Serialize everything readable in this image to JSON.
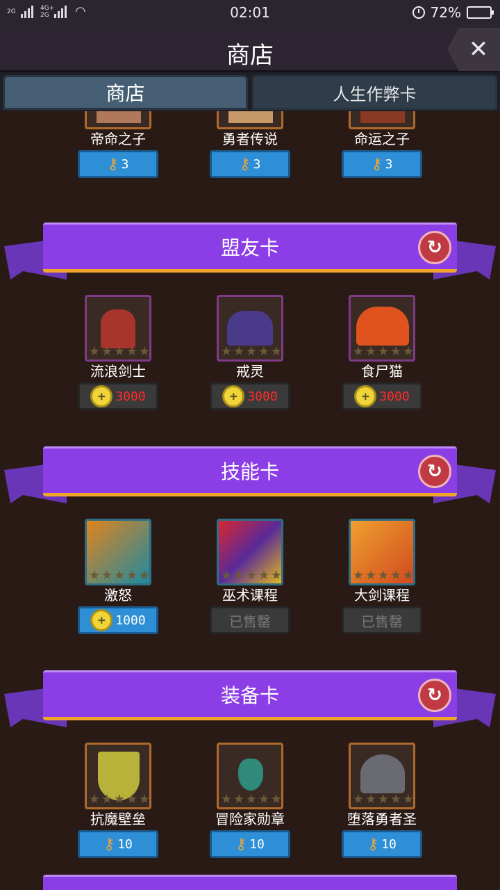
{
  "status_bar": {
    "network_1": "2G",
    "network_2": "4G+\n2G",
    "time": "02:01",
    "battery_percent": "72%",
    "battery_level": 0.72
  },
  "header": {
    "title": "商店",
    "close_label": "✕"
  },
  "tabs": [
    {
      "label": "商店",
      "active": true
    },
    {
      "label": "人生作弊卡",
      "active": false
    }
  ],
  "top_items": [
    {
      "name": "帝命之子",
      "price": "3",
      "currency": "key"
    },
    {
      "name": "勇者传说",
      "price": "3",
      "currency": "key"
    },
    {
      "name": "命运之子",
      "price": "3",
      "currency": "key"
    }
  ],
  "sections": [
    {
      "title": "盟友卡",
      "items": [
        {
          "name": "流浪剑士",
          "price": "3000",
          "currency": "coin",
          "style": "dark"
        },
        {
          "name": "戒灵",
          "price": "3000",
          "currency": "coin",
          "style": "dark"
        },
        {
          "name": "食尸猫",
          "price": "3000",
          "currency": "coin",
          "style": "dark"
        }
      ]
    },
    {
      "title": "技能卡",
      "items": [
        {
          "name": "激怒",
          "price": "1000",
          "currency": "coin",
          "style": "blue"
        },
        {
          "name": "巫术课程",
          "price": "已售罄",
          "currency": "none",
          "style": "sold"
        },
        {
          "name": "大剑课程",
          "price": "已售罄",
          "currency": "none",
          "style": "sold"
        }
      ]
    },
    {
      "title": "装备卡",
      "items": [
        {
          "name": "抗魔壁垒",
          "price": "10",
          "currency": "key",
          "style": "blue"
        },
        {
          "name": "冒险家勋章",
          "price": "10",
          "currency": "key",
          "style": "blue"
        },
        {
          "name": "堕落勇者圣",
          "price": "10",
          "currency": "key",
          "style": "blue"
        }
      ]
    }
  ],
  "colors": {
    "background": "#2a1a16",
    "banner": "#8c3ee6",
    "price_blue": "#2e8fd6",
    "price_red": "#ff2b2b"
  }
}
